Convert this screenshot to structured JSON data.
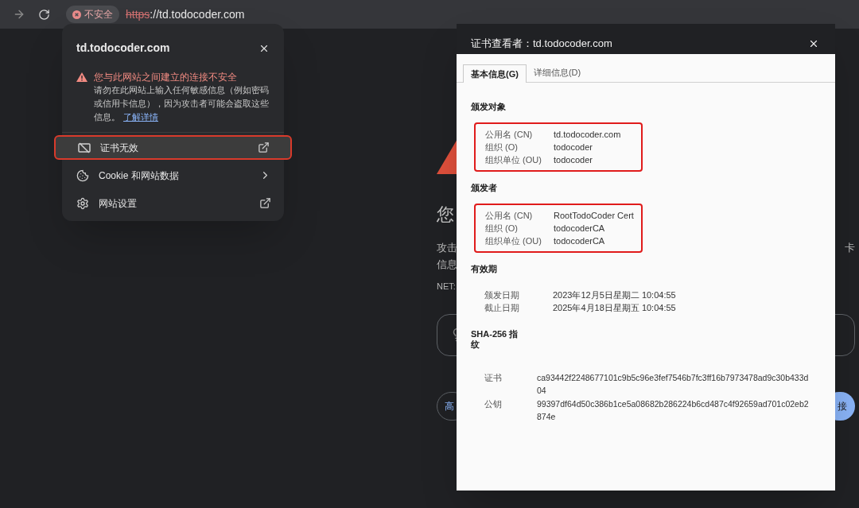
{
  "toolbar": {
    "security_chip": "不安全",
    "url_scheme": "https",
    "url_rest": "://td.todocoder.com"
  },
  "background_page": {
    "heading": "您",
    "line_1_start": "攻击",
    "line_1_end": "卡",
    "line_2_start": "信息",
    "code": "NET:",
    "left_button": "高",
    "right_button": "接"
  },
  "site_popup": {
    "title": "td.todocoder.com",
    "warning_title": "您与此网站之间建立的连接不安全",
    "warning_body": "请勿在此网站上输入任何敏感信息（例如密码或信用卡信息），因为攻击者可能会盗取这些信息。",
    "learn_more": "了解详情",
    "items": [
      {
        "kind": "certificate",
        "label": "证书无效",
        "highlighted": true
      },
      {
        "kind": "cookie",
        "label": "Cookie 和网站数据",
        "highlighted": false
      },
      {
        "kind": "settings",
        "label": "网站设置",
        "highlighted": false
      }
    ]
  },
  "certificate_viewer": {
    "title": "证书查看者：td.todocoder.com",
    "tabs": [
      {
        "label": "基本信息(G)",
        "selected": true
      },
      {
        "label": "详细信息(D)",
        "selected": false
      }
    ],
    "sections": [
      {
        "kind": "fields",
        "heading": "颁发对象",
        "highlighted": true,
        "fields": [
          {
            "label": "公用名 (CN)",
            "value": "td.todocoder.com"
          },
          {
            "label": "组织 (O)",
            "value": "todocoder"
          },
          {
            "label": "组织单位 (OU)",
            "value": "todocoder"
          }
        ]
      },
      {
        "kind": "fields",
        "heading": "颁发者",
        "highlighted": true,
        "fields": [
          {
            "label": "公用名 (CN)",
            "value": "RootTodoCoder Cert"
          },
          {
            "label": "组织 (O)",
            "value": "todocoderCA"
          },
          {
            "label": "组织单位 (OU)",
            "value": "todocoderCA"
          }
        ]
      },
      {
        "kind": "fields",
        "heading": "有效期",
        "highlighted": false,
        "fields": [
          {
            "label": "颁发日期",
            "value": "2023年12月5日星期二 10:04:55"
          },
          {
            "label": "截止日期",
            "value": "2025年4月18日星期五 10:04:55"
          }
        ]
      },
      {
        "kind": "fingerprint",
        "heading": "SHA-256 指纹",
        "highlighted": false,
        "fields": [
          {
            "label": "证书",
            "value": "ca93442f2248677101c9b5c96e3fef7546b7fc3ff16b7973478ad9c30b433d04"
          },
          {
            "label": "公钥",
            "value": "99397df64d50c386b1ce5a08682b286224b6cd487c4f92659ad701c02eb2874e"
          }
        ]
      }
    ]
  }
}
